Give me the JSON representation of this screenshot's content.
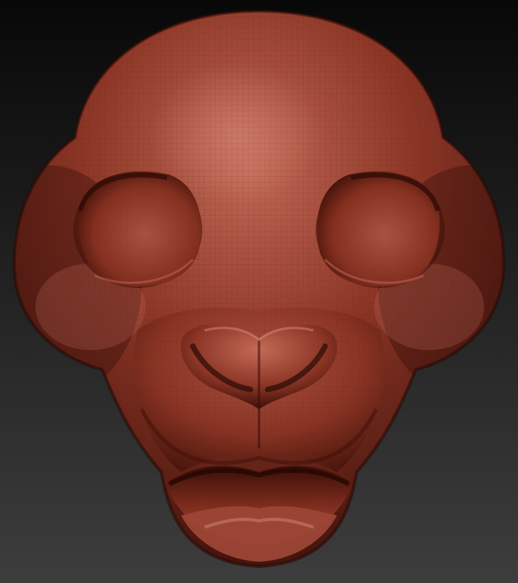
{
  "scene": {
    "subject": "sculpted-animal-head-mesh",
    "colors": {
      "background_top": "#080808",
      "background_bottom": "#3d3d3d",
      "clay_base": "#8c3626",
      "clay_highlight": "#c26a58",
      "clay_shadow": "#3e110a",
      "clay_deep_shadow": "#2a0a05",
      "wire_color": "#5a1e12"
    },
    "mesh_wireframe_visible": true
  }
}
